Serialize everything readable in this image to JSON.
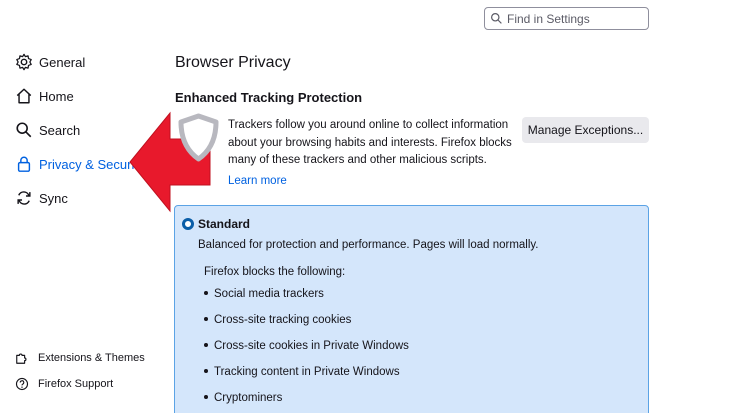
{
  "search": {
    "placeholder": "Find in Settings"
  },
  "sidebar": {
    "items": [
      {
        "label": "General",
        "icon": "gear-icon"
      },
      {
        "label": "Home",
        "icon": "home-icon"
      },
      {
        "label": "Search",
        "icon": "search-icon"
      },
      {
        "label": "Privacy & Security",
        "icon": "lock-icon",
        "active": true
      },
      {
        "label": "Sync",
        "icon": "sync-icon"
      }
    ],
    "footer": [
      {
        "label": "Extensions & Themes",
        "icon": "puzzle-icon"
      },
      {
        "label": "Firefox Support",
        "icon": "help-icon"
      }
    ]
  },
  "main": {
    "title": "Browser Privacy",
    "etp_heading": "Enhanced Tracking Protection",
    "etp_desc": "Trackers follow you around online to collect information about your browsing habits and interests. Firefox blocks many of these trackers and other malicious scripts.",
    "learn_more": "Learn more",
    "manage_button": "Manage Exceptions...",
    "standard": {
      "label": "Standard",
      "selected": true,
      "desc": "Balanced for protection and performance. Pages will load normally.",
      "blocks_heading": "Firefox blocks the following:",
      "blocks": [
        "Social media trackers",
        "Cross-site tracking cookies",
        "Cross-site cookies in Private Windows",
        "Tracking content in Private Windows",
        "Cryptominers"
      ]
    }
  },
  "colors": {
    "accent": "#0061e0",
    "arrow": "#e8192c",
    "selected_box": "#d4e6fb"
  }
}
